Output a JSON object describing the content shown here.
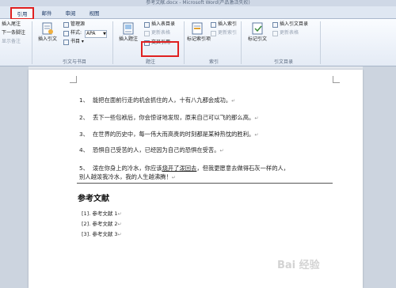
{
  "window": {
    "title": "参考文献.docx - Microsoft Word(产品激活失败)"
  },
  "tabs": [
    "引用",
    "邮件",
    "审阅",
    "视图"
  ],
  "ribbon": {
    "footnotes": {
      "insert_footnote": "插入尾注",
      "next_footnote": "下一条脚注",
      "show_notes": "显示备注"
    },
    "citations": {
      "insert_citation": "插入引文",
      "manage_sources": "管理源",
      "style_label": "样式:",
      "style_value": "APA",
      "bibliography": "书目",
      "group_label": "引文与书目"
    },
    "captions": {
      "insert_caption": "插入题注",
      "insert_table_of_figures": "插入表目录",
      "update_table": "更新表格",
      "cross_reference": "交叉引用",
      "group_label": "题注"
    },
    "index": {
      "mark_entry": "标记索引项",
      "insert_index": "插入索引",
      "update_index": "更新索引",
      "group_label": "索引"
    },
    "table_of_authorities": {
      "mark_citation": "标记引文",
      "insert_toa": "插入引文目录",
      "update_table": "更新表格",
      "group_label": "引文目录"
    }
  },
  "document": {
    "paragraphs": [
      {
        "num": "1、",
        "text": "能把在面前行走的机会抓住的人，十有八九都会成功。"
      },
      {
        "num": "2、",
        "text": "丢下一些包袱后，你会惊讶地发现，原来自己可以飞的那么高。"
      },
      {
        "num": "3、",
        "text": "在世界的历史中，每一伟大而高贵的时刻都是某种热忱的胜利。"
      },
      {
        "num": "4、",
        "text": "恐惧自己受苦的人，已经因为自己的恐惧在受苦。"
      },
      {
        "num": "5、",
        "text_before": "泼在你身上的冷水，你应该",
        "text_linked": "烧开了泼回去",
        "text_after": "，但我更愿意去做得石灰一样的人，",
        "text_line2": "别人越泼我冷水，我的人生越沸腾！"
      }
    ],
    "paragraph_mark": "↵",
    "references_heading": "参考文献",
    "references": [
      "[1]. 参考文献 1",
      "[2]. 参考文献 2",
      "[3]. 参考文献 3"
    ]
  },
  "watermark": "Bai 经验"
}
